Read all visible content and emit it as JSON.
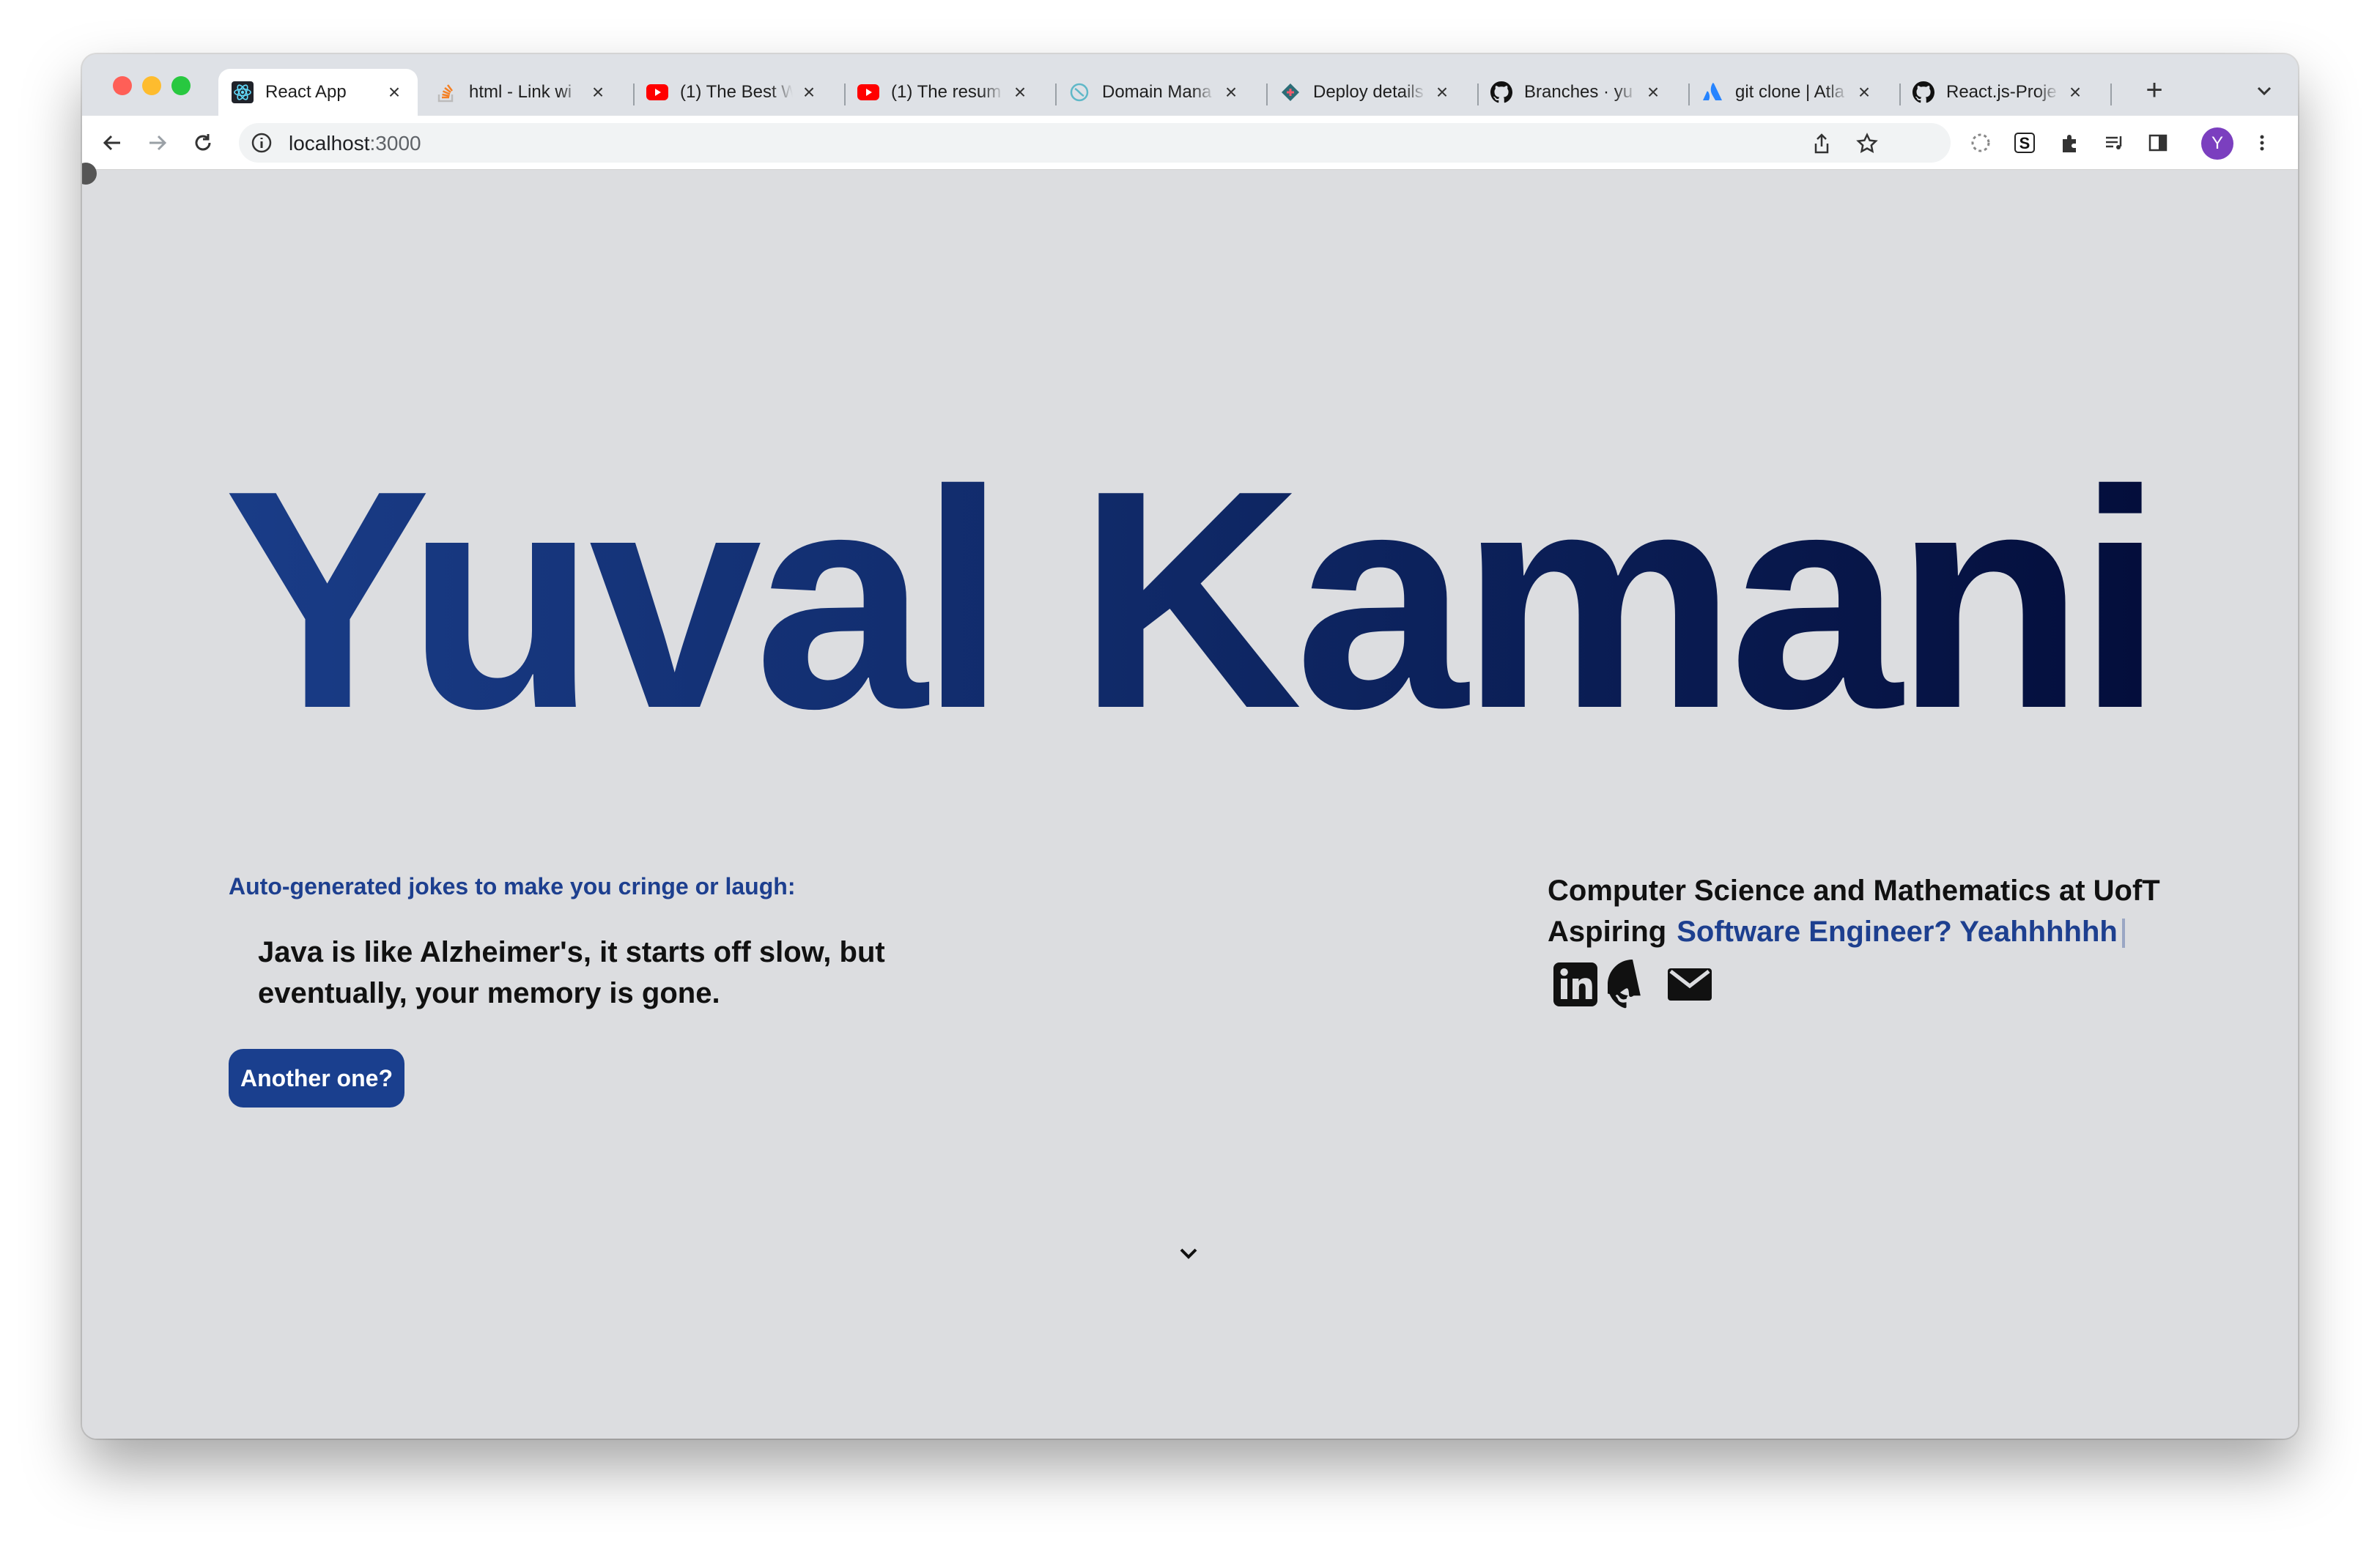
{
  "browser": {
    "tabs": [
      {
        "label": "React App",
        "icon": "react-icon",
        "active": true
      },
      {
        "label": "html - Link wi",
        "icon": "stackoverflow-icon"
      },
      {
        "label": "(1) The Best W",
        "icon": "youtube-icon"
      },
      {
        "label": "(1) The resum",
        "icon": "youtube-icon"
      },
      {
        "label": "Domain Mana",
        "icon": "domain-icon"
      },
      {
        "label": "Deploy details",
        "icon": "netlify-icon"
      },
      {
        "label": "Branches · yu",
        "icon": "github-icon"
      },
      {
        "label": "git clone | Atla",
        "icon": "atlassian-icon"
      },
      {
        "label": "React.js-Proje",
        "icon": "github-icon"
      }
    ],
    "url_host": "localhost",
    "url_port": ":3000",
    "avatar_letter": "Y"
  },
  "hero": {
    "name": "Yuval Kamani"
  },
  "jokes": {
    "heading": "Auto-generated jokes to make you cringe or laugh:",
    "joke": "Java is like Alzheimer's, it starts off slow, but eventually, your memory is gone.",
    "button_label": "Another one?"
  },
  "about": {
    "line1": "Computer Science and Mathematics at UofT",
    "line2_prefix": "Aspiring",
    "line2_typed": "Software Engineer? Yeahhhhhh"
  },
  "colors": {
    "accent": "#1d3f8f",
    "button": "#1a3f8e",
    "page_bg": "#dcdde0"
  }
}
